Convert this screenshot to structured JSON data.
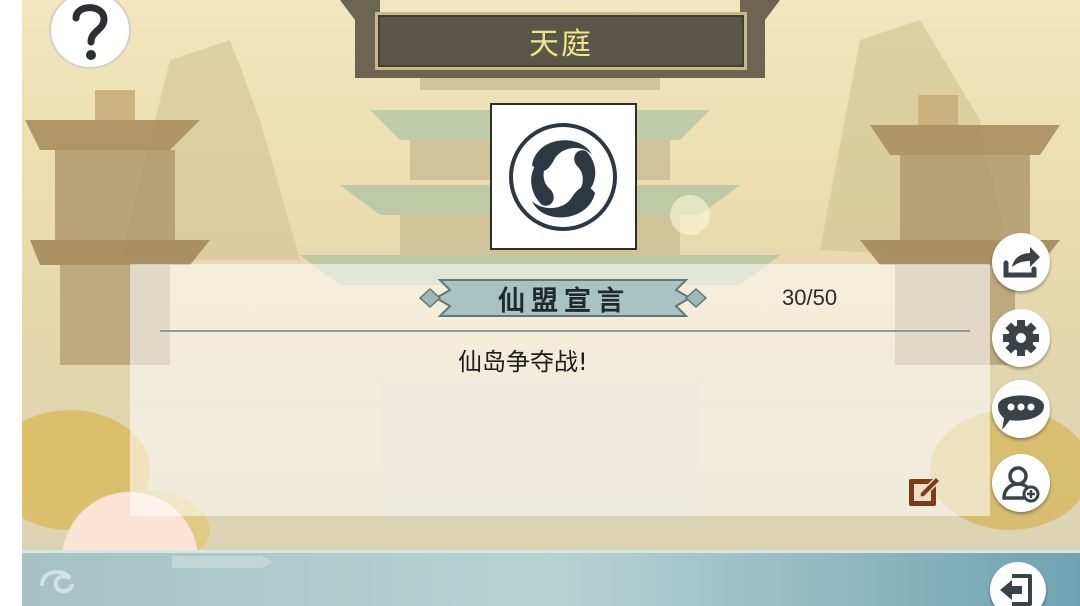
{
  "header": {
    "title": "天庭"
  },
  "declaration": {
    "heading": "仙盟宣言",
    "counter": "30/50",
    "text": "仙岛争夺战!"
  },
  "icons": {
    "help": "question-mark-icon",
    "emblem": "cloud-swirl-icon",
    "share": "share-icon",
    "settings": "gear-icon",
    "chat": "chat-bubble-icon",
    "add_friend": "add-user-icon",
    "edit": "edit-icon",
    "exit": "exit-icon"
  },
  "colors": {
    "title_text": "#f5e58a",
    "title_plate": "#5a5648",
    "ribbon": "#a9c3c3",
    "edit_icon": "#7a3c1c",
    "button_icon": "#3a4248"
  }
}
